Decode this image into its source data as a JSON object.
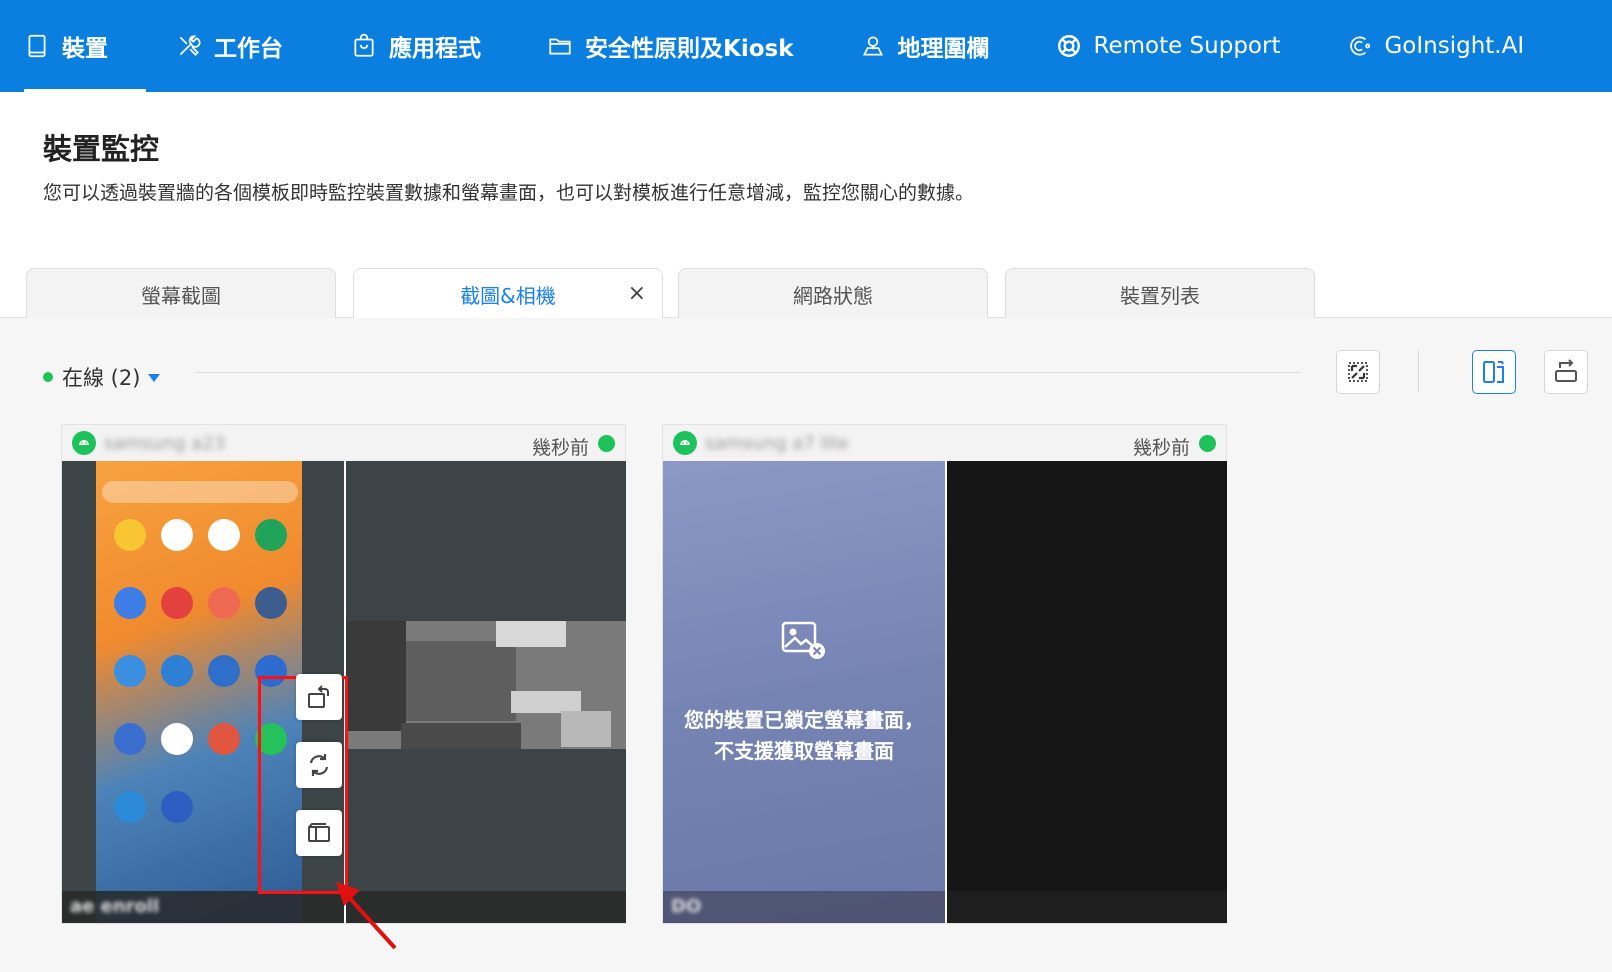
{
  "nav": {
    "items": [
      {
        "label": "裝置",
        "icon": "tablet-icon"
      },
      {
        "label": "工作台",
        "icon": "tools-icon"
      },
      {
        "label": "應用程式",
        "icon": "shopping-bag-icon"
      },
      {
        "label": "安全性原則及Kiosk",
        "icon": "folder-icon"
      },
      {
        "label": "地理圍欄",
        "icon": "geofence-icon"
      },
      {
        "label": "Remote Support",
        "icon": "lifebuoy-icon"
      },
      {
        "label": "GoInsight.AI",
        "icon": "ai-icon"
      }
    ],
    "active": "裝置"
  },
  "header": {
    "title": "裝置監控",
    "description": "您可以透過裝置牆的各個模板即時監控裝置數據和螢幕畫面，也可以對模板進行任意增減，監控您關心的數據。"
  },
  "tabs": [
    {
      "label": "螢幕截圖",
      "active": false
    },
    {
      "label": "截圖&相機",
      "active": true,
      "close": "×"
    },
    {
      "label": "網路狀態",
      "active": false
    },
    {
      "label": "裝置列表",
      "active": false
    }
  ],
  "toolbar": {
    "online_label": "在線 (2)",
    "buttons": [
      "fullscreen-icon",
      "portrait-layout-icon",
      "landscape-layout-icon"
    ]
  },
  "devices": [
    {
      "name": "samsung a23",
      "time_ago": "幾秒前",
      "footer": "ae enroll",
      "status_color": "#1ec25a"
    },
    {
      "name": "samsung a7 lite",
      "time_ago": "幾秒前",
      "footer": "DO",
      "status_color": "#1ec25a",
      "locked_message": "您的裝置已鎖定螢幕畫面，不支援獲取螢幕畫面"
    }
  ],
  "side_actions": [
    "rotate-icon",
    "refresh-icon",
    "switch-view-icon"
  ],
  "colors": {
    "nav_bg": "#0a7fe0",
    "accent": "#1a7ff0",
    "online": "#1ec25a",
    "highlight": "#ff0f0f"
  }
}
